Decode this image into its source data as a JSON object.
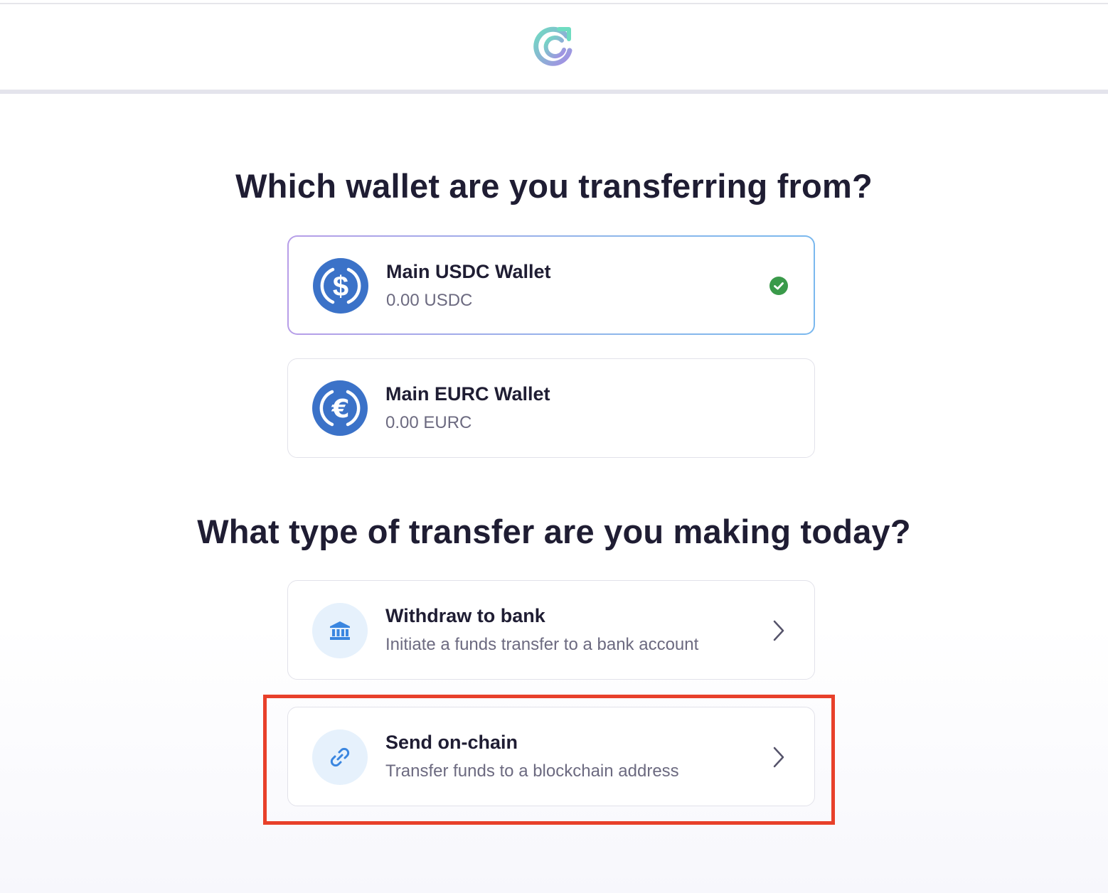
{
  "header": {
    "logo_icon": "circle-sync-logo-icon",
    "logo_colors": [
      "#6fdcc1",
      "#a58be6"
    ]
  },
  "wallet_section": {
    "title": "Which wallet are you transferring from?",
    "wallets": [
      {
        "name": "Main USDC Wallet",
        "balance": "0.00 USDC",
        "icon": "usdc-coin-icon",
        "selected": true
      },
      {
        "name": "Main EURC Wallet",
        "balance": "0.00 EURC",
        "icon": "eurc-coin-icon",
        "selected": false
      }
    ]
  },
  "transfer_section": {
    "title": "What type of transfer are you making today?",
    "options": [
      {
        "title": "Withdraw to bank",
        "description": "Initiate a funds transfer to a bank account",
        "icon": "bank-icon"
      },
      {
        "title": "Send on-chain",
        "description": "Transfer funds to a blockchain address",
        "icon": "link-icon",
        "highlighted": true
      }
    ]
  },
  "colors": {
    "coin_blue": "#3b72c8",
    "check_green": "#3a9a4a",
    "icon_blue": "#3a86e0",
    "icon_bg": "#e6f1fc",
    "highlight_red": "#e8402a",
    "selected_border": "#a7a8ea"
  }
}
